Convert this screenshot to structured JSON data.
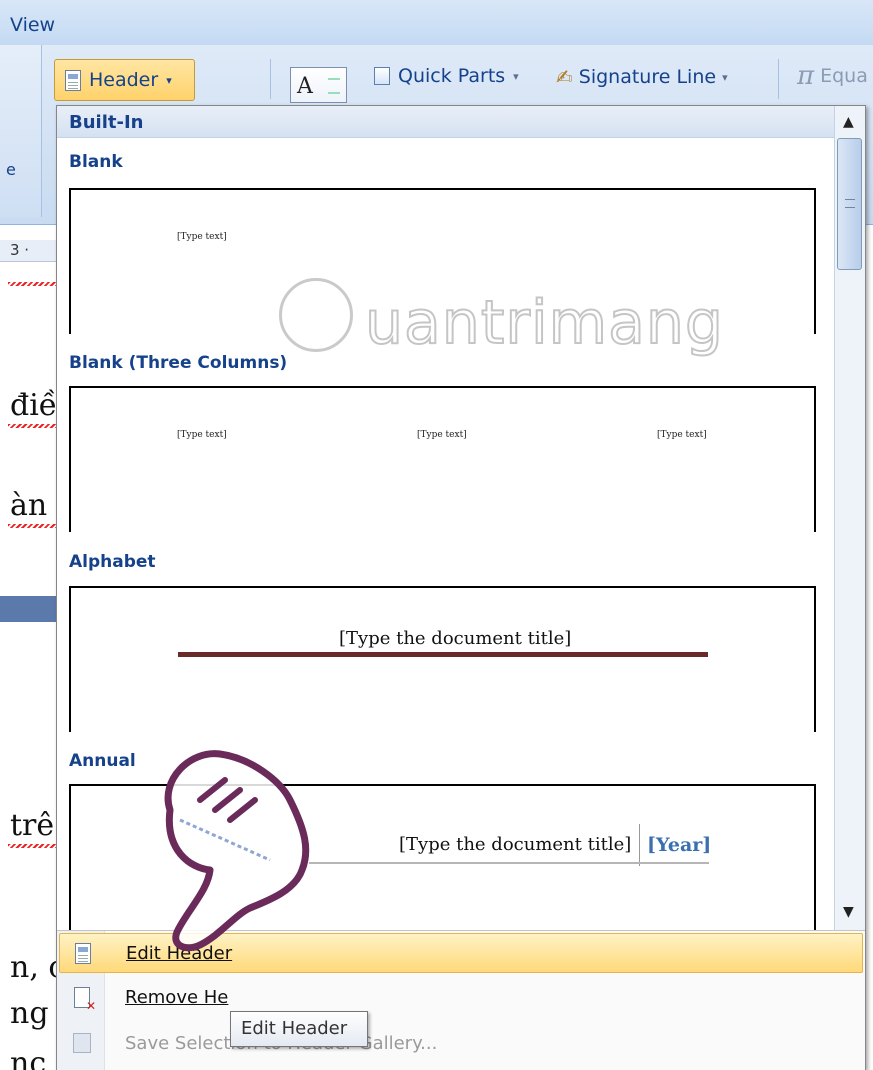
{
  "ribbon": {
    "tab_view": "View",
    "group_left_label": "e",
    "header_button": "Header",
    "text_box_glyph": "A",
    "quick_parts": "Quick Parts",
    "signature_line": "Signature Line",
    "equation": "Equa"
  },
  "document": {
    "ruler_text": "3 ·",
    "fragments": [
      "điề",
      "àn",
      "trê",
      "n, c",
      "ng c",
      "nc"
    ]
  },
  "gallery": {
    "section_header": "Built-In",
    "items": [
      {
        "name": "Blank",
        "placeholders": [
          "[Type text]"
        ]
      },
      {
        "name": "Blank (Three Columns)",
        "placeholders": [
          "[Type text]",
          "[Type text]",
          "[Type text]"
        ]
      },
      {
        "name": "Alphabet",
        "title": "[Type the document title]"
      },
      {
        "name": "Annual",
        "title": "[Type the document title]",
        "year": "[Year]"
      }
    ]
  },
  "menu": {
    "edit_header": "Edit Header",
    "remove_header": "Remove He",
    "save_selection": "Save Selection to Header Gallery..."
  },
  "tooltip": "Edit Header",
  "watermark": "uantrimang",
  "colors": {
    "highlight": "#ffd97a",
    "title_blue": "#15428b",
    "year_blue": "#3a6fb0",
    "rule_red": "#6b2a2a"
  }
}
